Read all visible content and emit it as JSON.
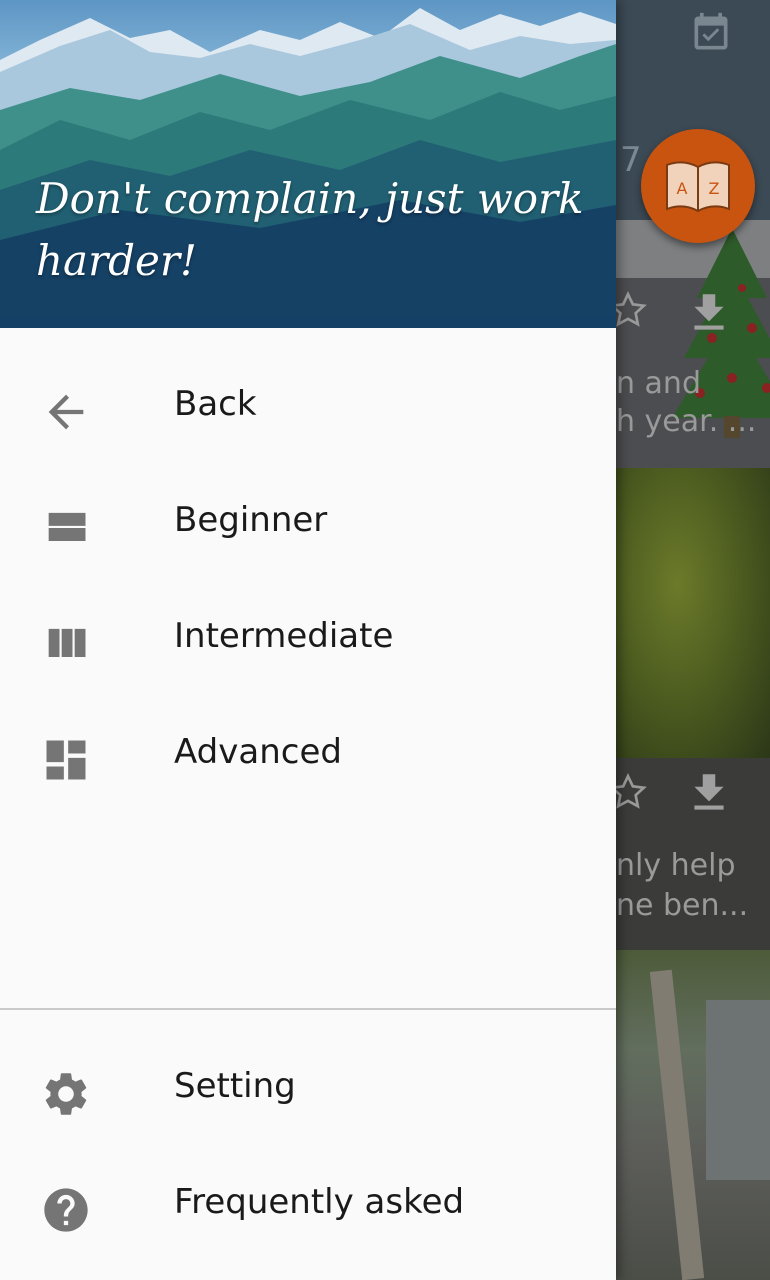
{
  "header": {
    "quote": "Don't complain, just work harder!"
  },
  "menu": {
    "items": [
      {
        "label": "Back",
        "icon": "arrow-left-icon"
      },
      {
        "label": "Beginner",
        "icon": "view-stream-icon"
      },
      {
        "label": "Intermediate",
        "icon": "view-column-icon"
      },
      {
        "label": "Advanced",
        "icon": "dashboard-icon"
      }
    ],
    "footer_items": [
      {
        "label": "Setting",
        "icon": "gear-icon"
      },
      {
        "label": "Frequently asked",
        "icon": "help-circle-icon"
      }
    ]
  },
  "background": {
    "date_fragment": "7",
    "fab_letters": [
      "A",
      "Z"
    ],
    "card1_text": [
      "n and",
      "h year. ..."
    ],
    "card2_text": [
      "nly help",
      "ne ben..."
    ]
  },
  "colors": {
    "drawer_bg": "#fafafa",
    "icon_gray": "#757575",
    "fab_orange": "#e36a14",
    "scrim": "rgba(0,0,0,0.55)"
  }
}
